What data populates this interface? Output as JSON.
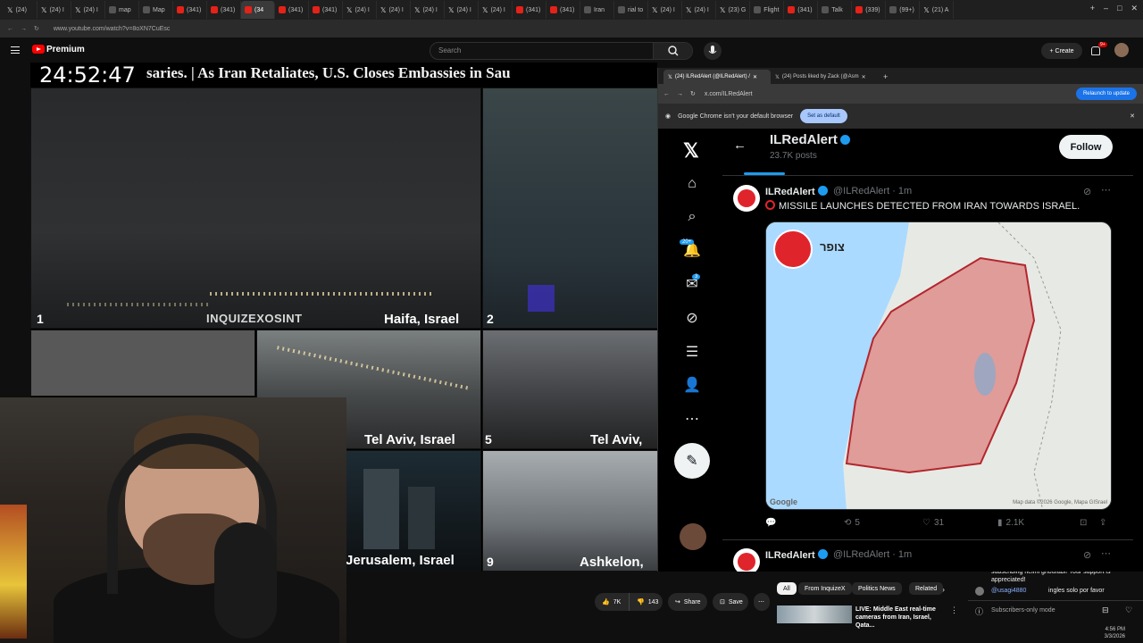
{
  "browser": {
    "tabs": [
      {
        "label": "(24)",
        "icon": "x"
      },
      {
        "label": "(24) I",
        "icon": "x"
      },
      {
        "label": "(24) I",
        "icon": "x"
      },
      {
        "label": "map",
        "icon": "g"
      },
      {
        "label": "Map",
        "icon": "m"
      },
      {
        "label": "(341)",
        "icon": "yt"
      },
      {
        "label": "(341)",
        "icon": "yt"
      },
      {
        "label": "(34",
        "icon": "yt",
        "active": true
      },
      {
        "label": "(341)",
        "icon": "yt"
      },
      {
        "label": "(341)",
        "icon": "yt"
      },
      {
        "label": "(24) I",
        "icon": "x"
      },
      {
        "label": "(24) I",
        "icon": "x"
      },
      {
        "label": "(24) I",
        "icon": "x"
      },
      {
        "label": "(24) I",
        "icon": "x"
      },
      {
        "label": "(24) I",
        "icon": "x"
      },
      {
        "label": "(341)",
        "icon": "yt"
      },
      {
        "label": "(341)",
        "icon": "yt"
      },
      {
        "label": "Iran",
        "icon": "g"
      },
      {
        "label": "rial to",
        "icon": "g"
      },
      {
        "label": "(24) I",
        "icon": "x"
      },
      {
        "label": "(24) I",
        "icon": "x"
      },
      {
        "label": "(23) G",
        "icon": "x"
      },
      {
        "label": "Flight",
        "icon": "g"
      },
      {
        "label": "(341)",
        "icon": "yt"
      },
      {
        "label": "Talk",
        "icon": "g"
      },
      {
        "label": "(339)",
        "icon": "yt"
      },
      {
        "label": "(99+)",
        "icon": "g"
      },
      {
        "label": "(21) A",
        "icon": "x"
      }
    ],
    "url": "www.youtube.com/watch?v=8oXN7CuEsc"
  },
  "youtube": {
    "brand": "Premium",
    "search_placeholder": "Search",
    "create_label": "Create",
    "notif_badge": "9+",
    "actions": {
      "like_count": "7K",
      "dislike_count": "143",
      "share_label": "Share",
      "save_label": "Save"
    },
    "chips": [
      "All",
      "From InquizeX",
      "Politics News",
      "Related"
    ],
    "recommended": {
      "title": "LIVE: Middle East real-time cameras from Iran, Israel, Qata..."
    },
    "chat": {
      "messages": [
        {
          "text": "subscribing helmi ghourabi! Your support is appreciated!"
        },
        {
          "user": "@usagi4880",
          "text": "ingles solo por favor"
        }
      ],
      "mode_label": "Subscribers-only mode"
    }
  },
  "video": {
    "timestamp": "24:52:47",
    "ticker": "saries.   |   As Iran Retaliates, U.S. Closes Embassies in Sau",
    "watermark": "INQUIZEXOSINT",
    "cells": [
      {
        "num": "1",
        "location": "Haifa, Israel"
      },
      {
        "num": "2",
        "location": ""
      },
      {
        "num": "",
        "location": "Tel Aviv, Israel"
      },
      {
        "num": "5",
        "location": "Tel Aviv,"
      },
      {
        "num": "",
        "location": "Jerusalem, Israel"
      },
      {
        "num": "9",
        "location": "Ashkelon,"
      }
    ]
  },
  "xwindow": {
    "tabs": [
      {
        "label": "(24) ILRedAlert (@ILRedAlert) /"
      },
      {
        "label": "(24) Posts liked by Zack (@Asm"
      }
    ],
    "url": "x.com/ILRedAlert",
    "relaunch_label": "Relaunch to update",
    "info_text": "Google Chrome isn't your default browser",
    "set_default_label": "Set as default",
    "nav_badges": {
      "notifications": "20+",
      "messages": "3"
    },
    "profile": {
      "name": "ILRedAlert",
      "posts_count": "23.7K posts",
      "follow_label": "Follow"
    },
    "post": {
      "name": "ILRedAlert",
      "handle": "@ILRedAlert",
      "time": "1m",
      "text": "MISSILE LAUNCHES DETECTED FROM IRAN TOWARDS ISRAEL.",
      "map_label": "צופר",
      "map_credit": "Map data ©2026 Google, Mapa GISrael",
      "google_label": "Google",
      "stats": {
        "replies": "",
        "reposts": "5",
        "likes": "31",
        "views": "2.1K"
      }
    },
    "post2": {
      "name": "ILRedAlert",
      "handle": "@ILRedAlert",
      "time": "1m"
    }
  },
  "taskbar": {
    "time": "4:56 PM",
    "date": "3/3/2026"
  },
  "colors": {
    "x_accent": "#1d9bf0",
    "alert_red": "#e0242c",
    "yt_red": "#ff0000"
  }
}
